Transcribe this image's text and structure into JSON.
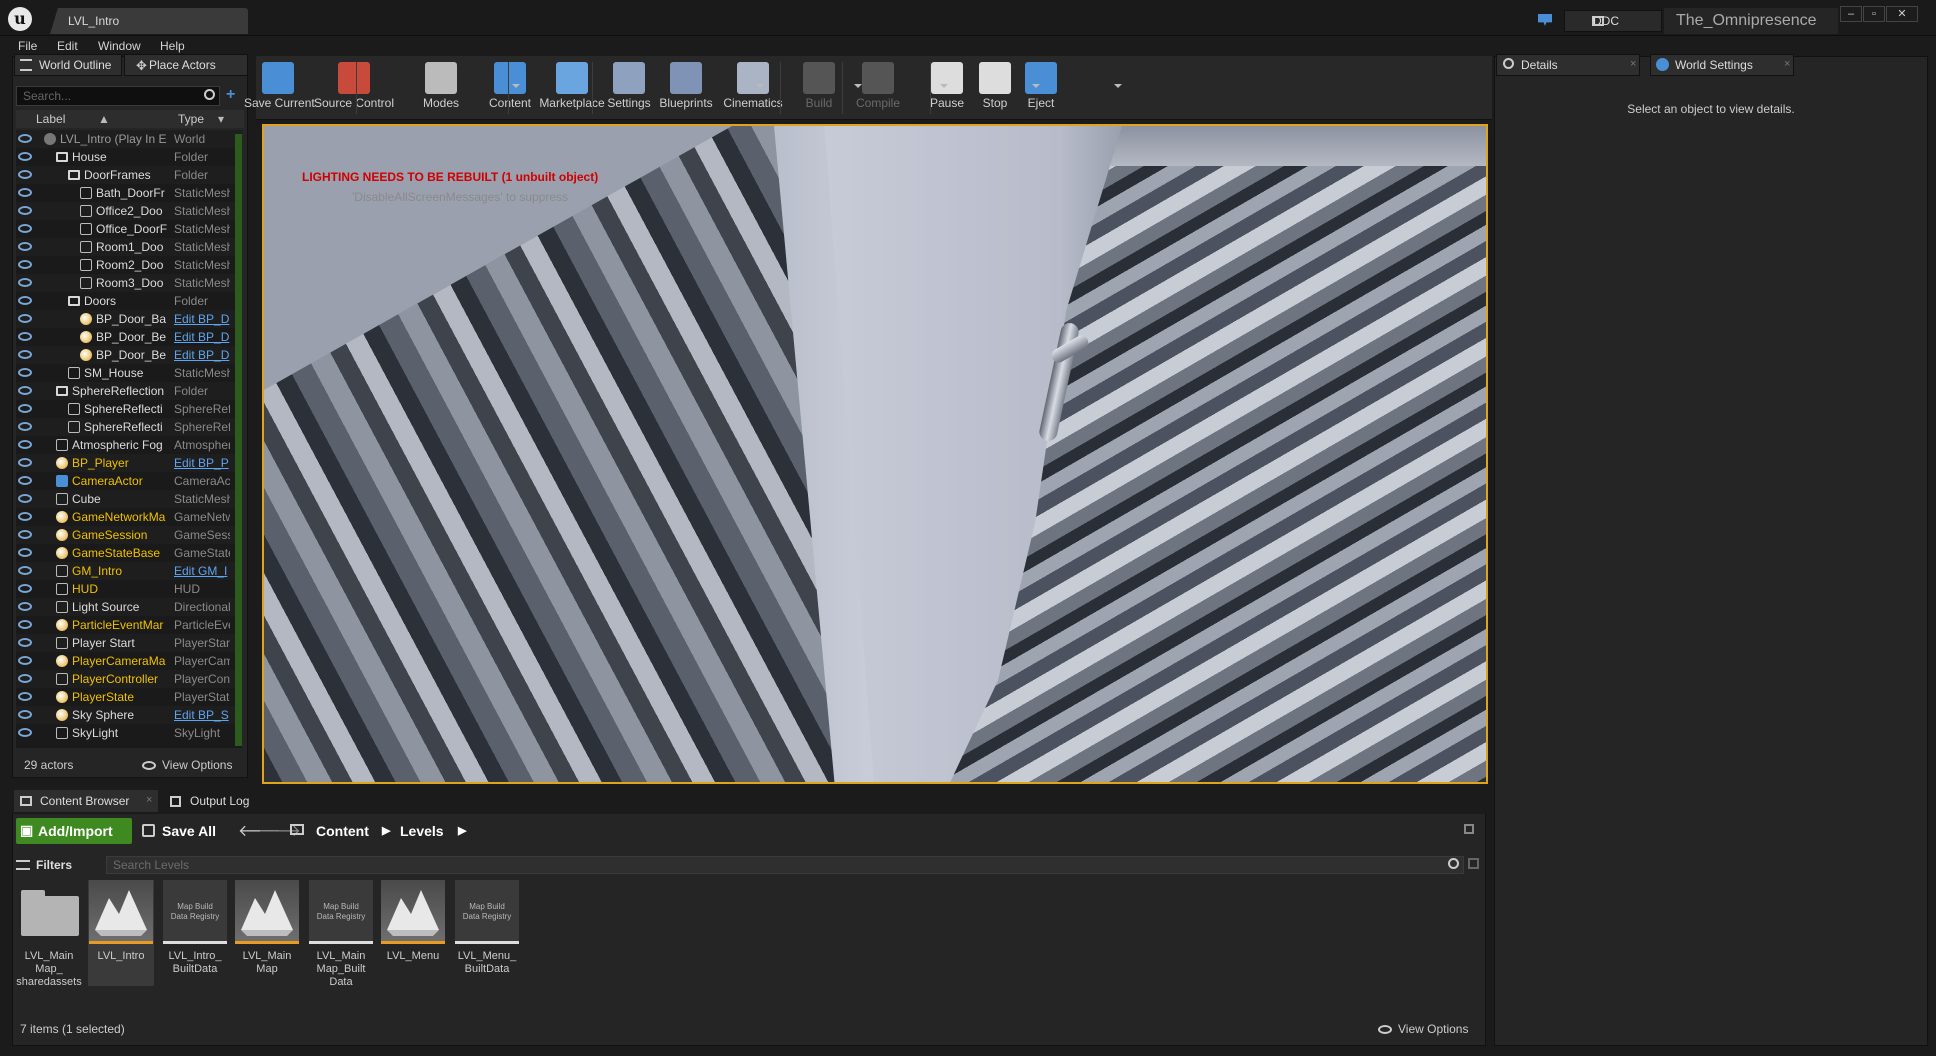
{
  "window": {
    "tab_title": "LVL_Intro",
    "ddc_label": "DDC",
    "project_name": "The_Omnipresence",
    "logo_letter": "u"
  },
  "menu": [
    "File",
    "Edit",
    "Window",
    "Help"
  ],
  "outliner": {
    "tabs": [
      "World Outline",
      "Place Actors"
    ],
    "search_placeholder": "Search...",
    "columns": [
      "Label",
      "Type"
    ],
    "rows": [
      {
        "label": "LVL_Intro (Play In E",
        "type": "World",
        "indent": 0,
        "icon": "world-icon",
        "color": "grey"
      },
      {
        "label": "House",
        "type": "Folder",
        "indent": 1,
        "icon": "folder-icon"
      },
      {
        "label": "DoorFrames",
        "type": "Folder",
        "indent": 2,
        "icon": "folder-icon"
      },
      {
        "label": "Bath_DoorFr",
        "type": "StaticMesh",
        "indent": 3,
        "icon": "mesh-icon"
      },
      {
        "label": "Office2_Doo",
        "type": "StaticMesh",
        "indent": 3,
        "icon": "mesh-icon"
      },
      {
        "label": "Office_DoorF",
        "type": "StaticMesh",
        "indent": 3,
        "icon": "mesh-icon"
      },
      {
        "label": "Room1_Doo",
        "type": "StaticMesh",
        "indent": 3,
        "icon": "mesh-icon"
      },
      {
        "label": "Room2_Doo",
        "type": "StaticMesh",
        "indent": 3,
        "icon": "mesh-icon"
      },
      {
        "label": "Room3_Doo",
        "type": "StaticMesh",
        "indent": 3,
        "icon": "mesh-icon"
      },
      {
        "label": "Doors",
        "type": "Folder",
        "indent": 2,
        "icon": "folder-icon"
      },
      {
        "label": "BP_Door_Ba",
        "type": "Edit BP_D",
        "indent": 3,
        "icon": "blueprint-icon",
        "link": true
      },
      {
        "label": "BP_Door_Be",
        "type": "Edit BP_D",
        "indent": 3,
        "icon": "blueprint-icon",
        "link": true
      },
      {
        "label": "BP_Door_Be",
        "type": "Edit BP_D",
        "indent": 3,
        "icon": "blueprint-icon",
        "link": true
      },
      {
        "label": "SM_House",
        "type": "StaticMesh",
        "indent": 2,
        "icon": "mesh-icon"
      },
      {
        "label": "SphereReflection",
        "type": "Folder",
        "indent": 1,
        "icon": "folder-icon"
      },
      {
        "label": "SphereReflecti",
        "type": "SphereRefl",
        "indent": 2,
        "icon": "sphere-reflection-icon"
      },
      {
        "label": "SphereReflecti",
        "type": "SphereRefl",
        "indent": 2,
        "icon": "sphere-reflection-icon"
      },
      {
        "label": "Atmospheric Fog",
        "type": "Atmospher",
        "indent": 1,
        "icon": "fog-icon"
      },
      {
        "label": "BP_Player",
        "type": "Edit BP_P",
        "indent": 1,
        "icon": "pawn-icon",
        "color": "yellow",
        "link": true
      },
      {
        "label": "CameraActor",
        "type": "CameraAc",
        "indent": 1,
        "icon": "camera-icon",
        "color": "yellow"
      },
      {
        "label": "Cube",
        "type": "StaticMesh",
        "indent": 1,
        "icon": "mesh-icon"
      },
      {
        "label": "GameNetworkMa",
        "type": "GameNetw",
        "indent": 1,
        "icon": "actor-icon",
        "color": "yellow"
      },
      {
        "label": "GameSession",
        "type": "GameSess",
        "indent": 1,
        "icon": "actor-icon",
        "color": "yellow"
      },
      {
        "label": "GameStateBase",
        "type": "GameState",
        "indent": 1,
        "icon": "actor-icon",
        "color": "yellow"
      },
      {
        "label": "GM_Intro",
        "type": "Edit GM_I",
        "indent": 1,
        "icon": "gamemode-icon",
        "color": "yellow",
        "link": true
      },
      {
        "label": "HUD",
        "type": "HUD",
        "indent": 1,
        "icon": "hud-icon",
        "color": "yellow"
      },
      {
        "label": "Light Source",
        "type": "Directional",
        "indent": 1,
        "icon": "light-icon"
      },
      {
        "label": "ParticleEventMar",
        "type": "ParticleEve",
        "indent": 1,
        "icon": "actor-icon",
        "color": "yellow"
      },
      {
        "label": "Player Start",
        "type": "PlayerStart",
        "indent": 1,
        "icon": "player-start-icon"
      },
      {
        "label": "PlayerCameraMa",
        "type": "PlayerCam",
        "indent": 1,
        "icon": "actor-icon",
        "color": "yellow"
      },
      {
        "label": "PlayerController",
        "type": "PlayerCont",
        "indent": 1,
        "icon": "controller-icon",
        "color": "yellow"
      },
      {
        "label": "PlayerState",
        "type": "PlayerState",
        "indent": 1,
        "icon": "actor-icon",
        "color": "yellow"
      },
      {
        "label": "Sky Sphere",
        "type": "Edit BP_S",
        "indent": 1,
        "icon": "actor-icon",
        "link": true
      },
      {
        "label": "SkyLight",
        "type": "SkyLight",
        "indent": 1,
        "icon": "skylight-icon"
      }
    ],
    "actor_count": "29 actors",
    "view_options": "View Options"
  },
  "toolbar": {
    "buttons": [
      {
        "label": "Save Current",
        "icon": "save-icon"
      },
      {
        "label": "Source Control",
        "icon": "source-control-icon"
      },
      {
        "label": "Modes",
        "icon": "modes-icon"
      },
      {
        "label": "Content",
        "icon": "content-icon"
      },
      {
        "label": "Marketplace",
        "icon": "marketplace-icon"
      },
      {
        "label": "Settings",
        "icon": "settings-icon"
      },
      {
        "label": "Blueprints",
        "icon": "blueprints-icon"
      },
      {
        "label": "Cinematics",
        "icon": "cinematics-icon"
      },
      {
        "label": "Build",
        "icon": "build-icon"
      },
      {
        "label": "Compile",
        "icon": "compile-icon"
      },
      {
        "label": "Pause",
        "icon": "pause-icon"
      },
      {
        "label": "Stop",
        "icon": "stop-icon"
      },
      {
        "label": "Eject",
        "icon": "eject-icon"
      }
    ]
  },
  "viewport": {
    "warning": "LIGHTING NEEDS TO BE REBUILT (1 unbuilt object)",
    "hint": "'DisableAllScreenMessages' to suppress"
  },
  "details": {
    "tabs": [
      "Details",
      "World Settings"
    ],
    "empty_message": "Select an object to view details."
  },
  "content_browser": {
    "tabs": [
      "Content Browser",
      "Output Log"
    ],
    "add_import": "Add/Import",
    "save_all": "Save All",
    "breadcrumb": [
      "Content",
      "Levels"
    ],
    "filters": "Filters",
    "search_placeholder": "Search Levels",
    "assets": [
      {
        "name": "LVL_Main\nMap_\nsharedassets",
        "kind": "folder"
      },
      {
        "name": "LVL_Intro",
        "kind": "map",
        "selected": true
      },
      {
        "name": "LVL_Intro_\nBuiltData",
        "kind": "registry"
      },
      {
        "name": "LVL_Main\nMap",
        "kind": "map"
      },
      {
        "name": "LVL_Main\nMap_Built\nData",
        "kind": "registry"
      },
      {
        "name": "LVL_Menu",
        "kind": "map"
      },
      {
        "name": "LVL_Menu_\nBuiltData",
        "kind": "registry"
      }
    ],
    "registry_caption": "Map Build\nData Registry",
    "status": "7 items (1 selected)",
    "view_options": "View Options"
  },
  "colors": {
    "accent": "#e0a41a",
    "add_import": "#3f8a20",
    "link": "#5fa4f0",
    "warning": "#d00000",
    "yellow_actor": "#f0c000"
  }
}
